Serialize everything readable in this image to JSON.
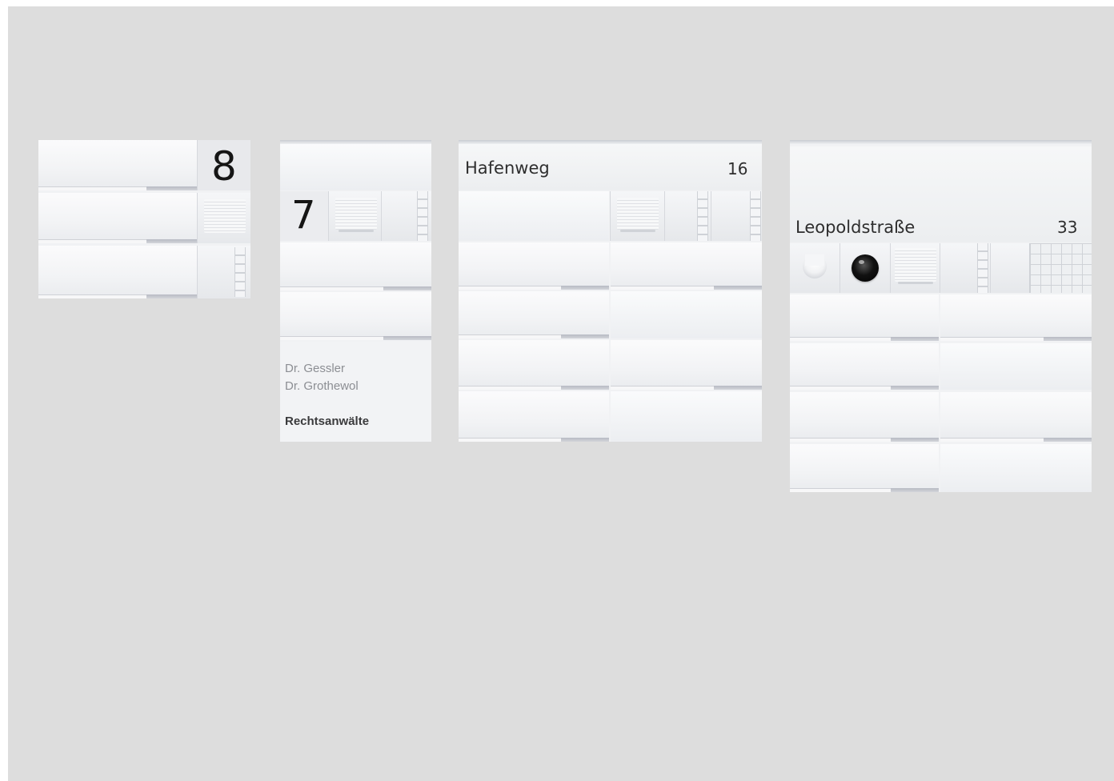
{
  "panels": {
    "panel_1": {
      "house_number": "8"
    },
    "panel_2": {
      "house_number": "7",
      "names": [
        "Dr. Gessler",
        "Dr. Grothewol"
      ],
      "firm": "Rechtsanwälte"
    },
    "panel_3": {
      "street": "Hafenweg",
      "house_number": "16"
    },
    "panel_4": {
      "street": "Leopoldstraße",
      "house_number": "33"
    }
  },
  "colors": {
    "background": "#dddddd",
    "panel": "#f1f2f4",
    "text": "#151515"
  },
  "icons": {
    "speaker": "speaker-grille-icon",
    "keypad": "keypad-icon",
    "camera": "camera-icon",
    "motion_sensor": "motion-sensor-icon"
  }
}
